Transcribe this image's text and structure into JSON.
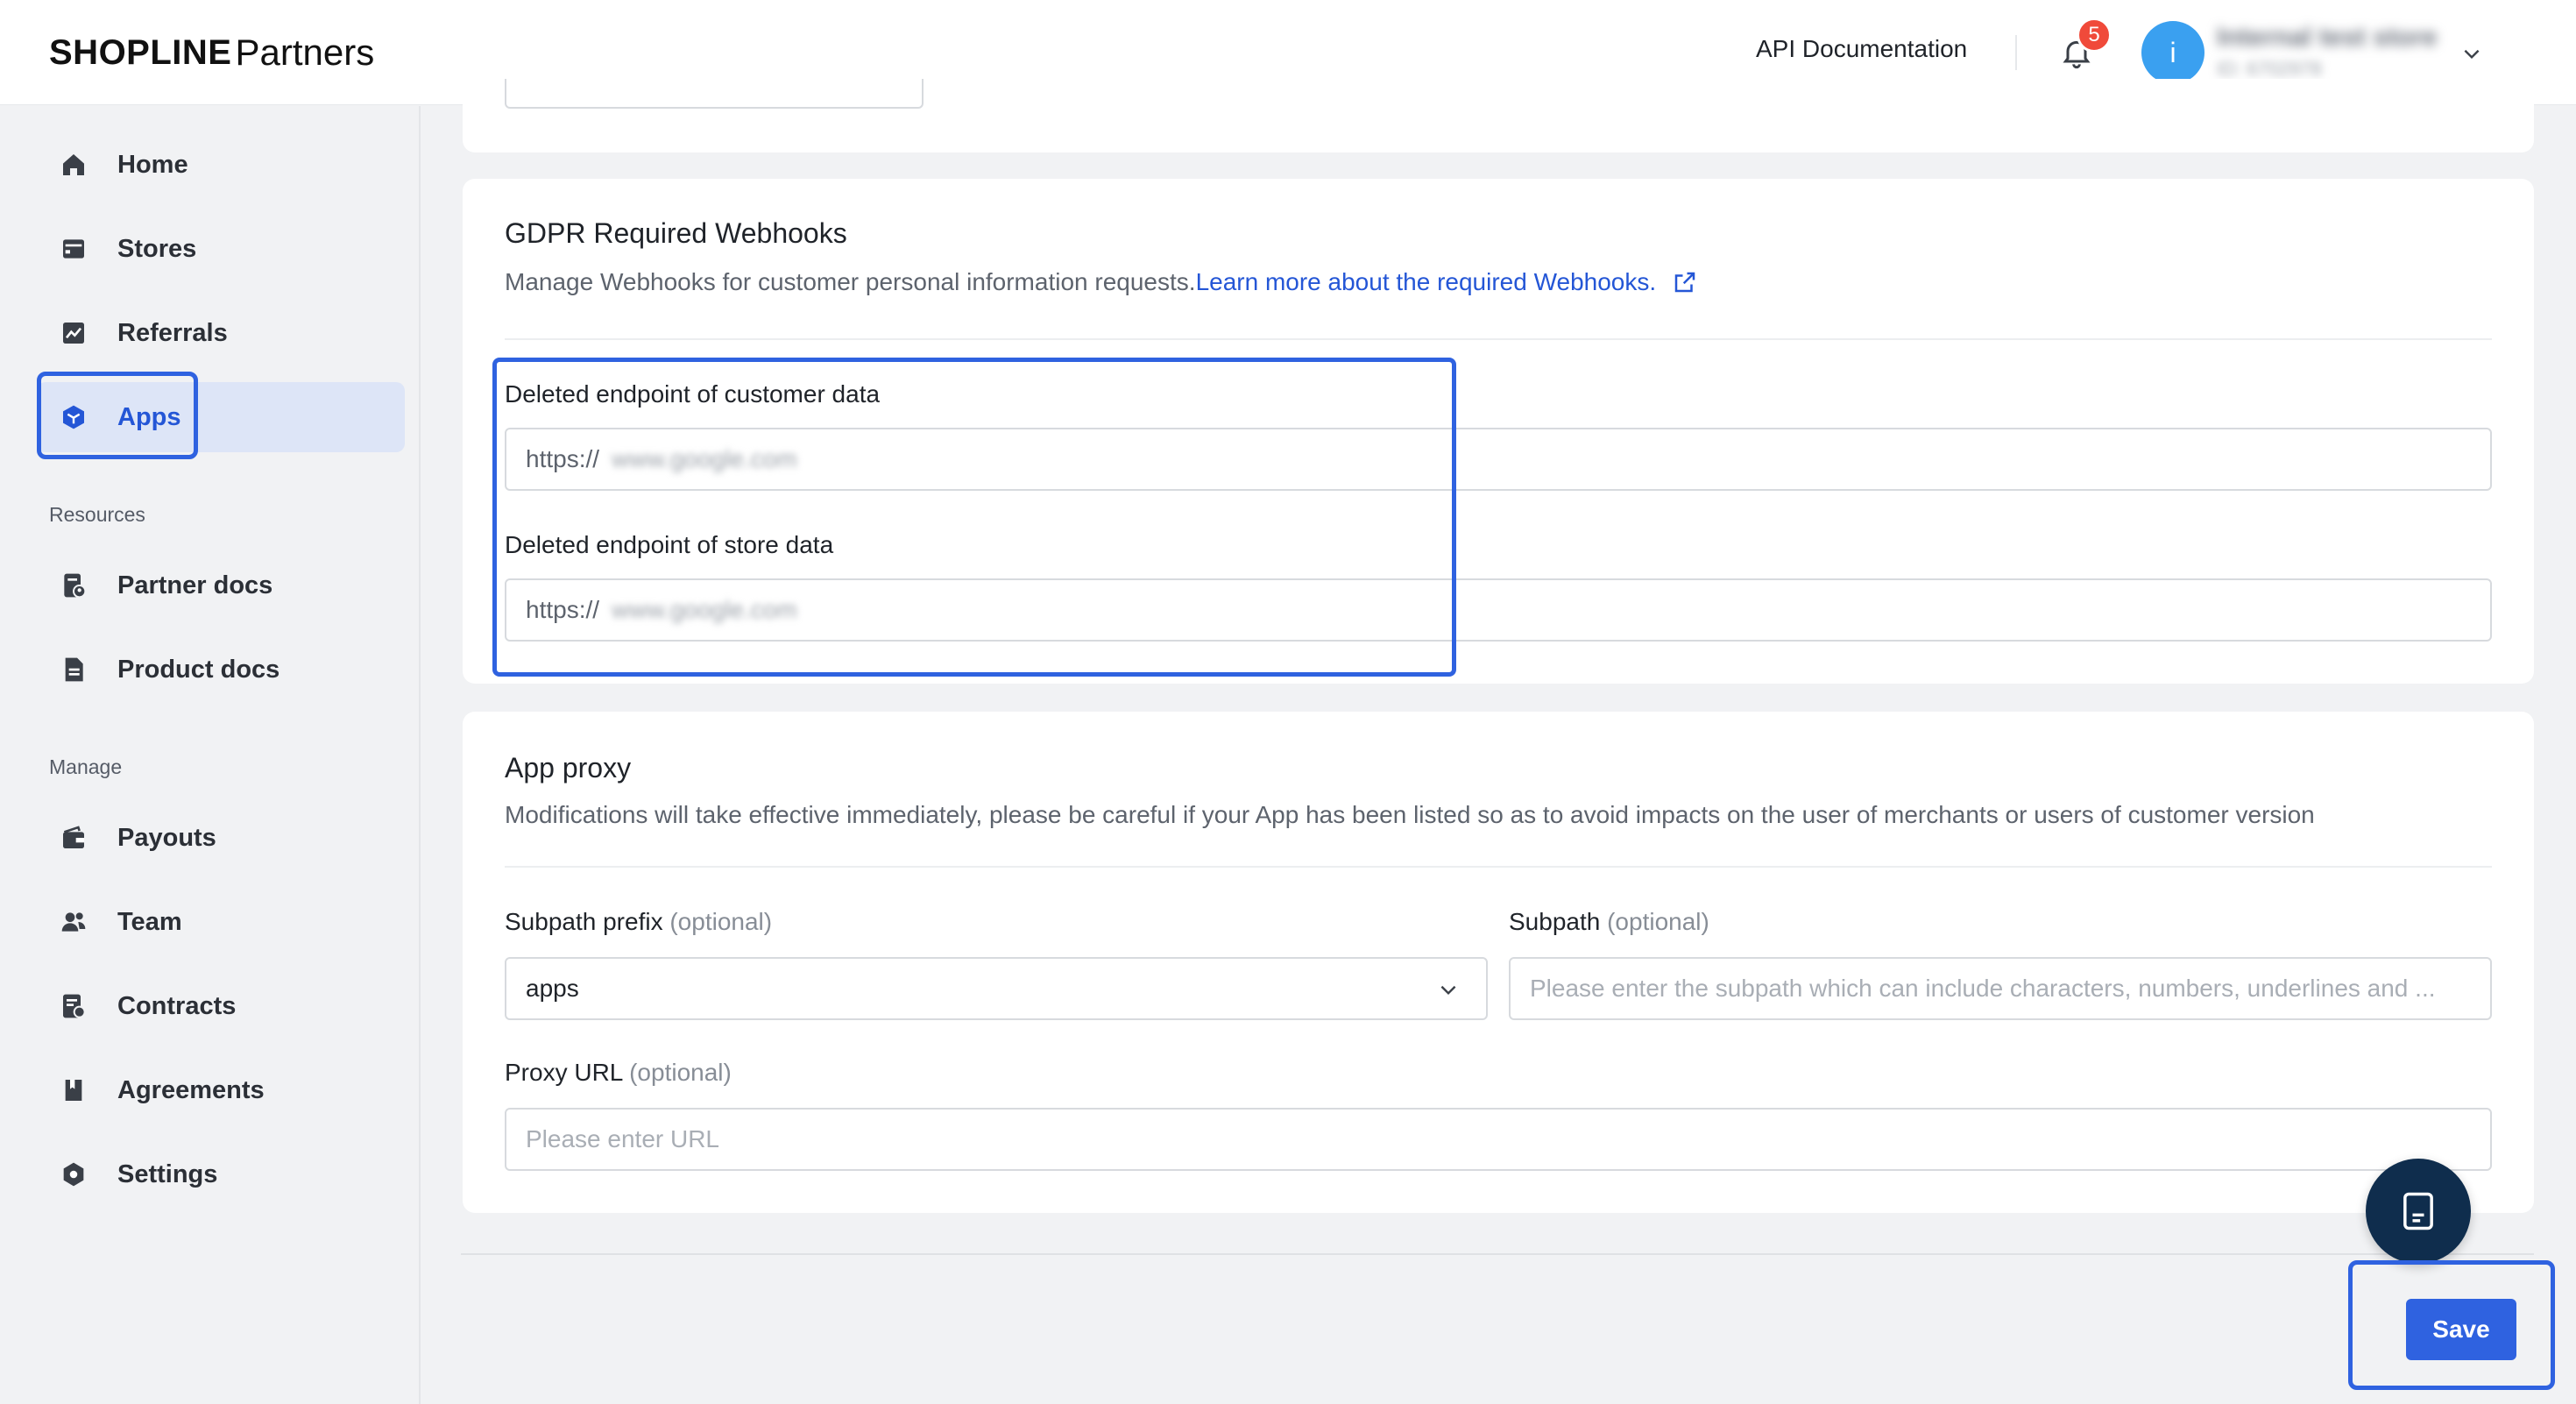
{
  "header": {
    "brand": "SHOPLINE",
    "brand_suffix": "Partners",
    "api_documentation": "API Documentation",
    "notification_count": "5",
    "avatar_initial": "i",
    "store_name": "Internal test store",
    "store_id": "ID: 6702978"
  },
  "sidebar": {
    "items": [
      {
        "label": "Home",
        "icon": "home-icon"
      },
      {
        "label": "Stores",
        "icon": "store-icon"
      },
      {
        "label": "Referrals",
        "icon": "chart-icon"
      },
      {
        "label": "Apps",
        "icon": "app-cube-icon",
        "active": true
      }
    ],
    "resources_label": "Resources",
    "resources": [
      {
        "label": "Partner docs",
        "icon": "partner-docs-icon"
      },
      {
        "label": "Product docs",
        "icon": "product-docs-icon"
      }
    ],
    "manage_label": "Manage",
    "manage": [
      {
        "label": "Payouts",
        "icon": "wallet-icon"
      },
      {
        "label": "Team",
        "icon": "team-icon"
      },
      {
        "label": "Contracts",
        "icon": "contract-icon"
      },
      {
        "label": "Agreements",
        "icon": "agreement-icon"
      },
      {
        "label": "Settings",
        "icon": "settings-icon"
      }
    ]
  },
  "gdpr": {
    "title": "GDPR Required Webhooks",
    "description": "Manage Webhooks for customer personal information requests.",
    "link": "Learn more about the required Webhooks.",
    "customer_label": "Deleted endpoint of customer data",
    "customer_prefix": "https://",
    "customer_value": "www.google.com",
    "store_label": "Deleted endpoint of store data",
    "store_prefix": "https://",
    "store_value": "www.google.com"
  },
  "app_proxy": {
    "title": "App proxy",
    "description": "Modifications will take effective immediately, please be careful if your App has been listed so as to avoid impacts on the user of merchants or users of customer version",
    "subpath_prefix_label": "Subpath prefix",
    "optional": "(optional)",
    "subpath_prefix_value": "apps",
    "subpath_label": "Subpath",
    "subpath_placeholder": "Please enter the subpath which can include characters, numbers, underlines and ...",
    "proxy_url_label": "Proxy URL",
    "proxy_url_placeholder": "Please enter URL"
  },
  "actions": {
    "save": "Save"
  },
  "colors": {
    "accent": "#2f62e0",
    "active_bg": "#dde5f7",
    "badge": "#f04a3a",
    "fab": "#0f2d4d"
  }
}
